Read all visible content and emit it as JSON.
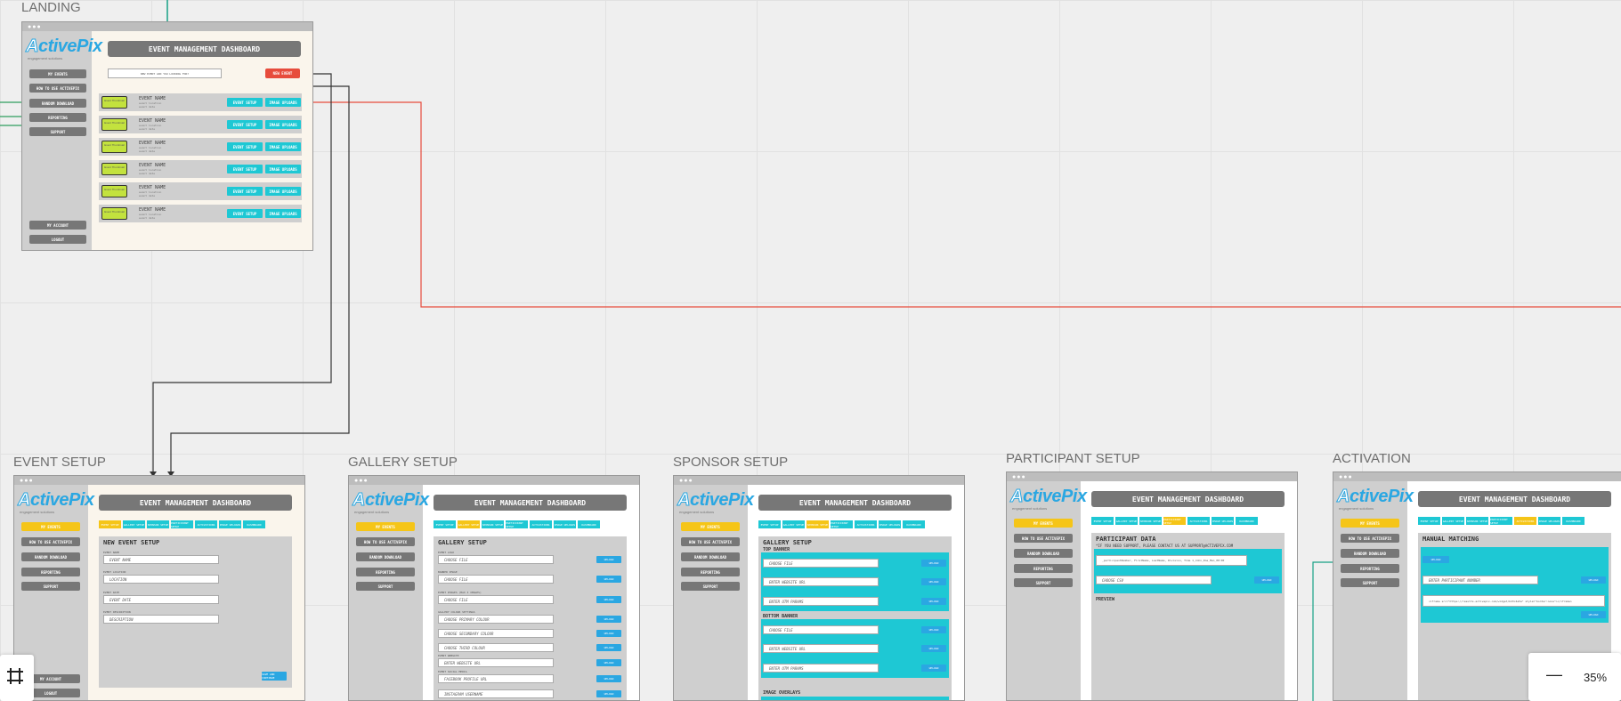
{
  "frames": {
    "landing": "LANDING",
    "event_setup": "EVENT SETUP",
    "gallery_setup": "GALLERY SETUP",
    "sponsor_setup": "SPONSOR SETUP",
    "participant_setup": "PARTICIPANT SETUP",
    "activation": "ACTIVATION"
  },
  "brand": {
    "logo_a": "A",
    "logo_ctive": "ctive",
    "logo_pix": "Pix",
    "tagline": "engagement solutions"
  },
  "dashboard_title": "EVENT MANAGEMENT DASHBOARD",
  "nav": {
    "my_events": "MY EVENTS",
    "how_to": "HOW TO USE ACTIVEPIX",
    "random_download": "RANDOM DOWNLOAD",
    "reporting": "REPORTING",
    "support": "SUPPORT",
    "my_account": "MY ACCOUNT",
    "logout": "LOGOUT"
  },
  "landing": {
    "search": "NEW EVENT ADD YOU LOOKING FOR?",
    "new_event": "NEW EVENT",
    "event_name": "EVENT NAME",
    "event_location": "event location",
    "event_date": "event date",
    "thumb": "Event Thumbnail",
    "event_setup_btn": "EVENT SETUP",
    "image_uploads_btn": "IMAGE UPLOADS"
  },
  "tabs": [
    "EVENT SETUP",
    "GALLERY SETUP",
    "SPONSOR SETUP",
    "PARTICIPANT SETUP",
    "ACTIVATIONS",
    "IMAGE UPLOADS",
    "DASHBOARD"
  ],
  "event_setup": {
    "title": "NEW EVENT SETUP",
    "fields": [
      {
        "label": "EVENT NAME",
        "value": "EVENT NAME"
      },
      {
        "label": "EVENT LOCATION",
        "value": "LOCATION"
      },
      {
        "label": "EVENT DATE",
        "value": "EVENT DATE"
      },
      {
        "label": "EVENT DESCRIPTION",
        "value": "DESCRIPTION"
      }
    ],
    "save_btn": "SAVE AND CONTINUE"
  },
  "gallery_setup": {
    "title": "GALLERY SETUP",
    "fields": [
      {
        "label": "EVENT LOGO",
        "value": "CHOOSE FILE"
      },
      {
        "label": "BANNER IMAGE",
        "value": "CHOOSE FILE"
      },
      {
        "label": "EVENT IMAGES (MAX 3 IMAGES)",
        "value": "CHOOSE FILE"
      },
      {
        "label": "GALLERY COLOUR SETTINGS",
        "value": "CHOOSE PRIMARY COLOUR"
      },
      {
        "label": "",
        "value": "CHOOSE SECONDARY COLOUR"
      },
      {
        "label": "",
        "value": "CHOOSE THIRD COLOUR"
      },
      {
        "label": "EVENT WEBSITE",
        "value": "ENTER WEBSITE URL"
      },
      {
        "label": "EVENT SOCIAL MEDIA",
        "value": "FACEBOOK PROFILE URL"
      },
      {
        "label": "",
        "value": "INSTAGRAM USERNAME"
      }
    ],
    "upload": "UPLOAD"
  },
  "sponsor_setup": {
    "title": "GALLERY SETUP",
    "top": "TOP BANNER",
    "bottom": "BOTTOM BANNER",
    "overlays": "IMAGE OVERLAYS",
    "choose_file": "CHOOSE FILE",
    "website": "ENTER WEBSITE URL",
    "utm": "ENTER UTM PARAMS"
  },
  "participant_setup": {
    "title": "PARTICIPANT DATA",
    "support_note": "*IF YOU NEED SUPPORT, PLEASE CONTACT US AT SUPPORT@ACTIVEPIX.COM",
    "sample": "_participantNumber, FirstName, LastName, Division, Time 1_John_Doe_Men_00:00",
    "choose_csv": "CHOOSE CSV",
    "upload": "UPLOAD",
    "preview": "PREVIEW"
  },
  "activation": {
    "title": "MANUAL MATCHING",
    "participant": "ENTER PARTICIPANT NUMBER",
    "embed": "<iframe src=\"https://results.activepix.com/widget/bd3c4a5a\" style=\"border:none\"></iframe>"
  },
  "zoom": {
    "level": "35%",
    "minus": "—"
  }
}
